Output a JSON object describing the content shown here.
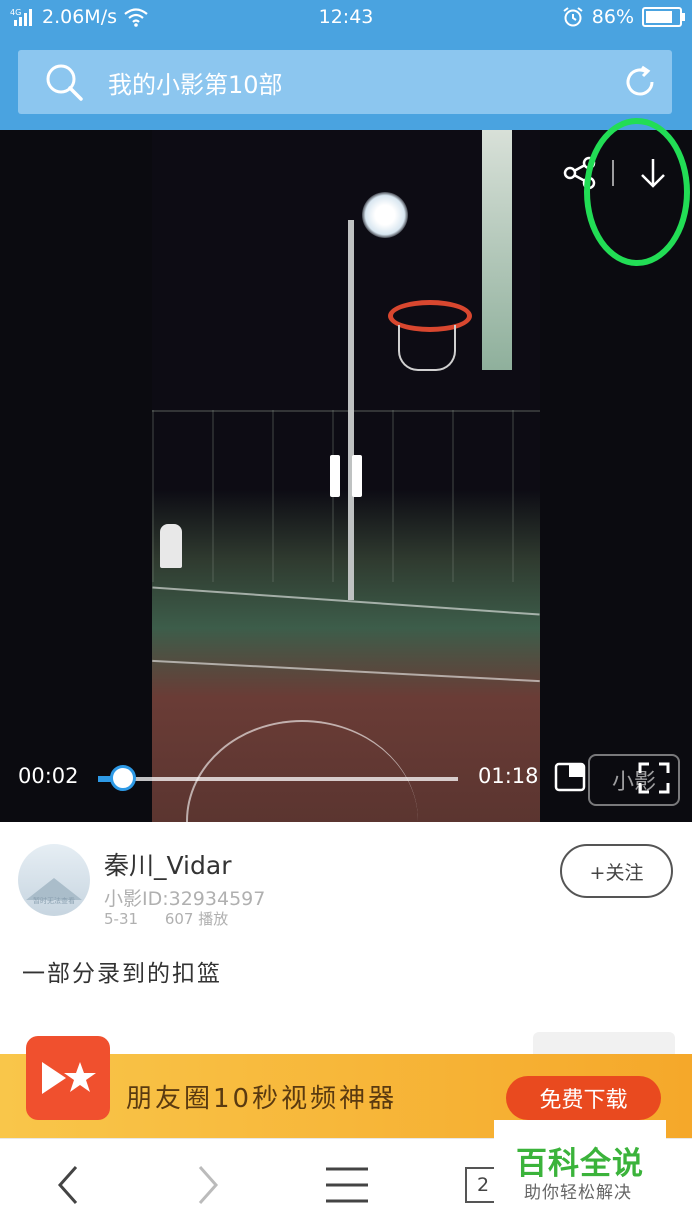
{
  "status_bar": {
    "network": "4G",
    "speed": "2.06M/s",
    "time": "12:43",
    "battery_percent": "86%",
    "battery_level": 0.86
  },
  "header": {
    "search_title": "我的小影第10部"
  },
  "video": {
    "current_time": "00:02",
    "duration": "01:18",
    "progress": 0.03,
    "watermark": "小影"
  },
  "post": {
    "avatar_caption": "暂时无法查看",
    "author": "秦川_Vidar",
    "user_id": "小影ID:32934597",
    "date": "5-31",
    "plays": "607 播放",
    "follow_label": "+关注",
    "description": "一部分录到的扣篮"
  },
  "ad_banner": {
    "text": "朋友圈10秒视频神器",
    "button": "免费下载"
  },
  "browser_nav": {
    "tab_count": "2"
  },
  "watermark": {
    "title": "百科全说",
    "subtitle": "助你轻松解决"
  },
  "colors": {
    "primary": "#4aa3e0",
    "progress": "#2e9ae6",
    "ad_bg": "#f9c64a",
    "ad_button": "#e94a1f",
    "highlight": "#22dd55",
    "watermark_green": "#3bb33b"
  }
}
